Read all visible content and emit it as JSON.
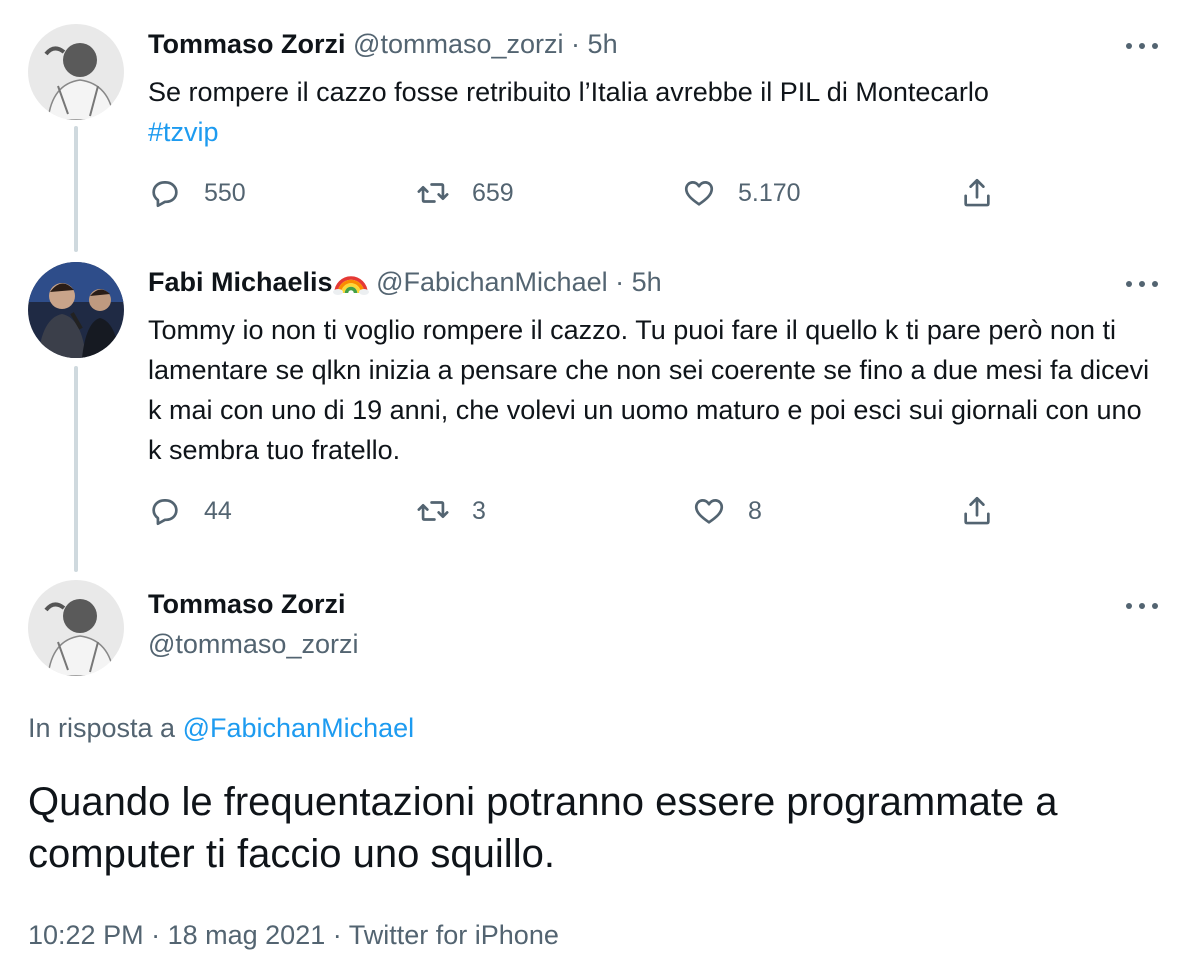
{
  "tweets": [
    {
      "name": "Tommaso Zorzi",
      "handle": "@tommaso_zorzi",
      "sep": "·",
      "time": "5h",
      "text": "Se rompere il cazzo fosse retribuito l’Italia avrebbe il PIL di Montecarlo",
      "hashtag": "#tzvip",
      "replies": "550",
      "retweets": "659",
      "likes": "5.170"
    },
    {
      "name": "Fabi Michaelis",
      "name_emoji": "rainbow-emoji",
      "handle": "@FabichanMichael",
      "sep": "·",
      "time": "5h",
      "text": "Tommy io non ti voglio rompere il cazzo. Tu puoi fare il quello k ti pare però non ti lamentare se qlkn inizia a pensare che non sei coerente se fino a due mesi fa dicevi k mai con uno di 19 anni, che volevi un uomo maturo e poi esci sui giornali con uno k sembra tuo fratello.",
      "replies": "44",
      "retweets": "3",
      "likes": "8"
    }
  ],
  "main_tweet": {
    "name": "Tommaso Zorzi",
    "handle": "@tommaso_zorzi",
    "reply_prefix": "In risposta a",
    "reply_to": "@FabichanMichael",
    "text": "Quando le frequentazioni potranno essere programmate a computer ti faccio uno squillo.",
    "time": "10:22 PM",
    "date": "18 mag 2021",
    "source": "Twitter for iPhone",
    "sep": "·"
  },
  "icons": {
    "reply": "reply-icon",
    "retweet": "retweet-icon",
    "like": "heart-icon",
    "share": "share-icon",
    "more": "more-icon"
  },
  "colors": {
    "text": "#0f1419",
    "secondary": "#536471",
    "link": "#1d9bf0",
    "thread_line": "#cfd9de"
  }
}
